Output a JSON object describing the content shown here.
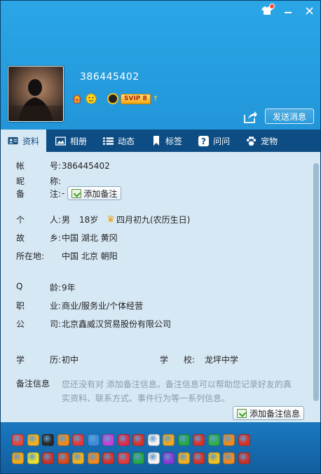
{
  "profile": {
    "uin_display": "386445402",
    "svip_label": "SVIP 8",
    "send_message_label": "发送消息"
  },
  "tabs": [
    {
      "label": "资料",
      "icon": "profile-card-icon"
    },
    {
      "label": "相册",
      "icon": "photo-icon"
    },
    {
      "label": "动态",
      "icon": "list-icon"
    },
    {
      "label": "标签",
      "icon": "bookmark-icon"
    },
    {
      "label": "问问",
      "icon": "question-icon"
    },
    {
      "label": "宠物",
      "icon": "paw-icon"
    }
  ],
  "info": {
    "account": {
      "label": [
        "帐",
        "号:"
      ],
      "value": "386445402"
    },
    "nickname": {
      "label": [
        "昵",
        "称:"
      ],
      "value": ""
    },
    "remark": {
      "label": [
        "备",
        "注:"
      ],
      "value": "-",
      "add_label": "添加备注"
    },
    "personal": {
      "label": [
        "个",
        "人:"
      ],
      "gender": "男",
      "age": "18岁",
      "birthday": "四月初九(农历生日)"
    },
    "hometown": {
      "label": [
        "故",
        "乡:"
      ],
      "value": "中国 湖北 黄冈"
    },
    "location": {
      "label": [
        "所在地:"
      ],
      "value": "中国 北京 朝阳"
    },
    "qage": {
      "label": [
        "Q",
        "龄:"
      ],
      "value": "9年"
    },
    "job": {
      "label": [
        "职",
        "业:"
      ],
      "value": "商业/服务业/个体经营"
    },
    "company": {
      "label": [
        "公",
        "司:"
      ],
      "value": "北京鑫威汉贸易股份有限公司"
    },
    "education": {
      "label": [
        "学",
        "历:"
      ],
      "value": "初中"
    },
    "school": {
      "label": [
        "学",
        "校:"
      ],
      "value": "龙坪中学"
    },
    "remark_info": {
      "title": "备注信息",
      "desc_line1": "您还没有对  添加备注信息。备注信息可以帮助您记录好友的真",
      "desc_line2": "实资料、联系方式、事件行为等一系列信息。",
      "button_label": "添加备注信息"
    }
  },
  "colors": {
    "header_top": "#2aa6e6",
    "tab_bar": "#0e4d84",
    "content_bg": "#d7e8f5",
    "bottom_bar": "#1a78bf"
  },
  "badge_row1": [
    "#e8453c",
    "#f2b01e",
    "#2a2a2a",
    "#f08a1c",
    "#e23a3a",
    "#3b8de0",
    "#c043d8",
    "#e02a4a",
    "#d8322a",
    "#f5f5f5",
    "#f3a81b",
    "#26a84a",
    "#d8322a",
    "#2fb04a",
    "#f08a1c",
    "#d8322a"
  ],
  "badge_row2": [
    "#f3a81b",
    "#e8e030",
    "#c8322a",
    "#d84a1a",
    "#f2b01e",
    "#f08a1c",
    "#d8322a",
    "#e23a3a",
    "#26a84a",
    "#f5f5f5",
    "#8a3ad8",
    "#f2b01e",
    "#d8322a",
    "#f3c01e",
    "#f08a1c",
    "#c8322a"
  ]
}
